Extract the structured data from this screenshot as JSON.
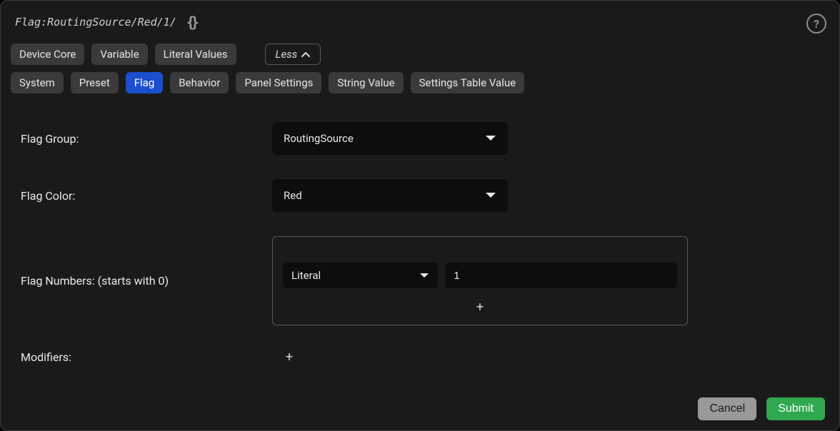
{
  "header": {
    "path": "Flag:RoutingSource/Red/1/"
  },
  "tags_row1": {
    "device_core": "Device Core",
    "variable": "Variable",
    "literal_values": "Literal Values"
  },
  "less_label": "Less",
  "tags_row2": {
    "system": "System",
    "preset": "Preset",
    "flag": "Flag",
    "behavior": "Behavior",
    "panel_settings": "Panel Settings",
    "string_value": "String Value",
    "settings_table_value": "Settings Table Value"
  },
  "fields": {
    "flag_group": {
      "label": "Flag Group:",
      "value": "RoutingSource"
    },
    "flag_color": {
      "label": "Flag Color:",
      "value": "Red"
    },
    "flag_numbers": {
      "label": "Flag Numbers: (starts with 0)",
      "type_value": "Literal",
      "number_value": "1"
    },
    "modifiers": {
      "label": "Modifiers:"
    }
  },
  "footer": {
    "cancel": "Cancel",
    "submit": "Submit"
  }
}
